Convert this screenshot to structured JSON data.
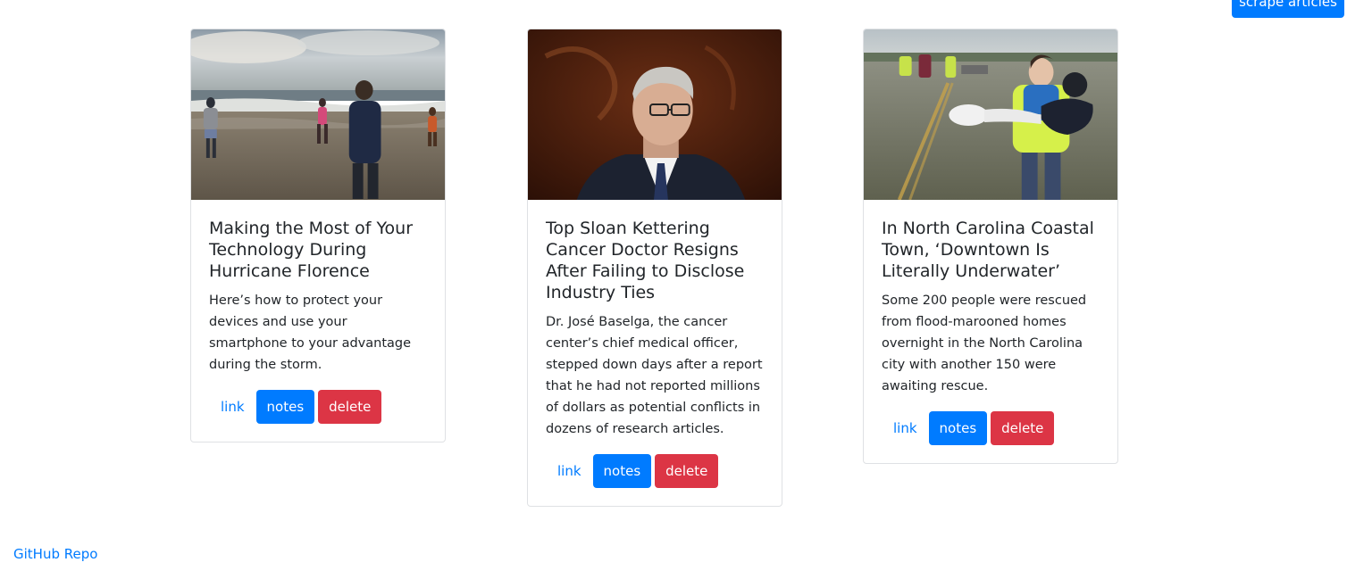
{
  "header": {
    "scrape_label": "scrape articles"
  },
  "articles": [
    {
      "title": "Making the Most of Your Technology During Hurricane Florence",
      "summary": "Here’s how to protect your devices and use your smartphone to your advantage during the storm.",
      "link_label": "link",
      "notes_label": "notes",
      "delete_label": "delete"
    },
    {
      "title": "Top Sloan Kettering Cancer Doctor Resigns After Failing to Disclose Industry Ties",
      "summary": "Dr. José Baselga, the cancer center’s chief medical officer, stepped down days after a report that he had not reported millions of dollars as potential conflicts in dozens of research articles.",
      "link_label": "link",
      "notes_label": "notes",
      "delete_label": "delete"
    },
    {
      "title": "In North Carolina Coastal Town, ‘Downtown Is Literally Underwater’",
      "summary": "Some 200 people were rescued from flood-marooned homes overnight in the North Carolina city with another 150 were awaiting rescue.",
      "link_label": "link",
      "notes_label": "notes",
      "delete_label": "delete"
    }
  ],
  "footer": {
    "repo_label": "GitHub Repo"
  },
  "colors": {
    "primary": "#007bff",
    "danger": "#dc3545"
  }
}
